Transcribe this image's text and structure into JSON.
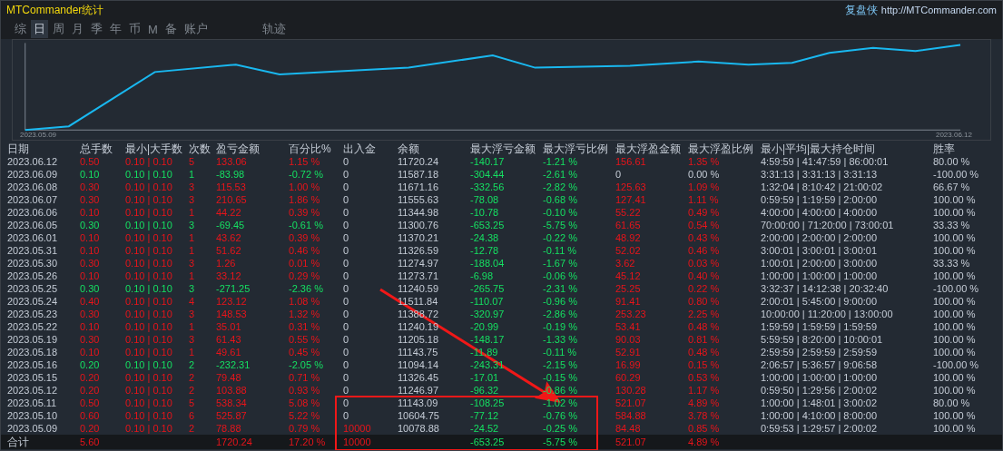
{
  "window": {
    "title": "MTCommander统计",
    "brand": "复盘侠",
    "link": "http://MTCommander.com"
  },
  "tabs": [
    {
      "label": "综",
      "selected": false
    },
    {
      "label": "日",
      "selected": true
    },
    {
      "label": "周",
      "selected": false
    },
    {
      "label": "月",
      "selected": false
    },
    {
      "label": "季",
      "selected": false
    },
    {
      "label": "年",
      "selected": false
    },
    {
      "label": "币",
      "selected": false
    },
    {
      "label": "M",
      "selected": false
    },
    {
      "label": "备",
      "selected": false
    },
    {
      "label": "账户",
      "selected": false
    }
  ],
  "extra_tab": {
    "label": "轨迹",
    "selected": false
  },
  "chart": {
    "start_label": "2023.05.09",
    "end_label": "2023.06.12"
  },
  "columns": [
    "日期",
    "总手数",
    "最小|大手数",
    "次数",
    "盈亏金额",
    "百分比%",
    "出入金",
    "余额",
    "最大浮亏金额",
    "最大浮亏比例",
    "最大浮盈金额",
    "最大浮盈比例",
    "最小|平均|最大持仓时间",
    "胜率"
  ],
  "rows": [
    {
      "date": "2023.06.12",
      "lots": "0.50",
      "lot_range": "0.10 | 0.10",
      "trades": "5",
      "pnl": "133.06",
      "pct": "1.15 %",
      "deposit": "0",
      "balance": "11720.24",
      "max_dd": "-140.17",
      "max_dd_pct": "-1.21 %",
      "max_gain": "156.61",
      "max_gain_pct": "1.35 %",
      "hold_times": "4:59:59 | 41:47:59 | 86:00:01",
      "win_rate": "80.00 %",
      "loss": false,
      "flat_gain": false,
      "deposit_marked": false
    },
    {
      "date": "2023.06.09",
      "lots": "0.10",
      "lot_range": "0.10 | 0.10",
      "trades": "1",
      "pnl": "-83.98",
      "pct": "-0.72 %",
      "deposit": "0",
      "balance": "11587.18",
      "max_dd": "-304.44",
      "max_dd_pct": "-2.61 %",
      "max_gain": "0",
      "max_gain_pct": "0.00 %",
      "hold_times": "3:31:13 | 3:31:13 | 3:31:13",
      "win_rate": "-100.00 %",
      "loss": true,
      "flat_gain": true,
      "deposit_marked": false
    },
    {
      "date": "2023.06.08",
      "lots": "0.30",
      "lot_range": "0.10 | 0.10",
      "trades": "3",
      "pnl": "115.53",
      "pct": "1.00 %",
      "deposit": "0",
      "balance": "11671.16",
      "max_dd": "-332.56",
      "max_dd_pct": "-2.82 %",
      "max_gain": "125.63",
      "max_gain_pct": "1.09 %",
      "hold_times": "1:32:04 | 8:10:42 | 21:00:02",
      "win_rate": "66.67 %",
      "loss": false,
      "flat_gain": false,
      "deposit_marked": false
    },
    {
      "date": "2023.06.07",
      "lots": "0.30",
      "lot_range": "0.10 | 0.10",
      "trades": "3",
      "pnl": "210.65",
      "pct": "1.86 %",
      "deposit": "0",
      "balance": "11555.63",
      "max_dd": "-78.08",
      "max_dd_pct": "-0.68 %",
      "max_gain": "127.41",
      "max_gain_pct": "1.11 %",
      "hold_times": "0:59:59 | 1:19:59 | 2:00:00",
      "win_rate": "100.00 %",
      "loss": false,
      "flat_gain": false,
      "deposit_marked": false
    },
    {
      "date": "2023.06.06",
      "lots": "0.10",
      "lot_range": "0.10 | 0.10",
      "trades": "1",
      "pnl": "44.22",
      "pct": "0.39 %",
      "deposit": "0",
      "balance": "11344.98",
      "max_dd": "-10.78",
      "max_dd_pct": "-0.10 %",
      "max_gain": "55.22",
      "max_gain_pct": "0.49 %",
      "hold_times": "4:00:00 | 4:00:00 | 4:00:00",
      "win_rate": "100.00 %",
      "loss": false,
      "flat_gain": false,
      "deposit_marked": false
    },
    {
      "date": "2023.06.05",
      "lots": "0.30",
      "lot_range": "0.10 | 0.10",
      "trades": "3",
      "pnl": "-69.45",
      "pct": "-0.61 %",
      "deposit": "0",
      "balance": "11300.76",
      "max_dd": "-653.25",
      "max_dd_pct": "-5.75 %",
      "max_gain": "61.65",
      "max_gain_pct": "0.54 %",
      "hold_times": "70:00:00 | 71:20:00 | 73:00:01",
      "win_rate": "33.33 %",
      "loss": true,
      "flat_gain": false,
      "deposit_marked": false
    },
    {
      "date": "2023.06.01",
      "lots": "0.10",
      "lot_range": "0.10 | 0.10",
      "trades": "1",
      "pnl": "43.62",
      "pct": "0.39 %",
      "deposit": "0",
      "balance": "11370.21",
      "max_dd": "-24.38",
      "max_dd_pct": "-0.22 %",
      "max_gain": "48.92",
      "max_gain_pct": "0.43 %",
      "hold_times": "2:00:00 | 2:00:00 | 2:00:00",
      "win_rate": "100.00 %",
      "loss": false,
      "flat_gain": false,
      "deposit_marked": false
    },
    {
      "date": "2023.05.31",
      "lots": "0.10",
      "lot_range": "0.10 | 0.10",
      "trades": "1",
      "pnl": "51.62",
      "pct": "0.46 %",
      "deposit": "0",
      "balance": "11326.59",
      "max_dd": "-12.78",
      "max_dd_pct": "-0.11 %",
      "max_gain": "52.02",
      "max_gain_pct": "0.46 %",
      "hold_times": "3:00:01 | 3:00:01 | 3:00:01",
      "win_rate": "100.00 %",
      "loss": false,
      "flat_gain": false,
      "deposit_marked": false
    },
    {
      "date": "2023.05.30",
      "lots": "0.30",
      "lot_range": "0.10 | 0.10",
      "trades": "3",
      "pnl": "1.26",
      "pct": "0.01 %",
      "deposit": "0",
      "balance": "11274.97",
      "max_dd": "-188.04",
      "max_dd_pct": "-1.67 %",
      "max_gain": "3.62",
      "max_gain_pct": "0.03 %",
      "hold_times": "1:00:01 | 2:00:00 | 3:00:00",
      "win_rate": "33.33 %",
      "loss": false,
      "flat_gain": false,
      "deposit_marked": false
    },
    {
      "date": "2023.05.26",
      "lots": "0.10",
      "lot_range": "0.10 | 0.10",
      "trades": "1",
      "pnl": "33.12",
      "pct": "0.29 %",
      "deposit": "0",
      "balance": "11273.71",
      "max_dd": "-6.98",
      "max_dd_pct": "-0.06 %",
      "max_gain": "45.12",
      "max_gain_pct": "0.40 %",
      "hold_times": "1:00:00 | 1:00:00 | 1:00:00",
      "win_rate": "100.00 %",
      "loss": false,
      "flat_gain": false,
      "deposit_marked": false
    },
    {
      "date": "2023.05.25",
      "lots": "0.30",
      "lot_range": "0.10 | 0.10",
      "trades": "3",
      "pnl": "-271.25",
      "pct": "-2.36 %",
      "deposit": "0",
      "balance": "11240.59",
      "max_dd": "-265.75",
      "max_dd_pct": "-2.31 %",
      "max_gain": "25.25",
      "max_gain_pct": "0.22 %",
      "hold_times": "3:32:37 | 14:12:38 | 20:32:40",
      "win_rate": "-100.00 %",
      "loss": true,
      "flat_gain": false,
      "deposit_marked": false
    },
    {
      "date": "2023.05.24",
      "lots": "0.40",
      "lot_range": "0.10 | 0.10",
      "trades": "4",
      "pnl": "123.12",
      "pct": "1.08 %",
      "deposit": "0",
      "balance": "11511.84",
      "max_dd": "-110.07",
      "max_dd_pct": "-0.96 %",
      "max_gain": "91.41",
      "max_gain_pct": "0.80 %",
      "hold_times": "2:00:01 | 5:45:00 | 9:00:00",
      "win_rate": "100.00 %",
      "loss": false,
      "flat_gain": false,
      "deposit_marked": false
    },
    {
      "date": "2023.05.23",
      "lots": "0.30",
      "lot_range": "0.10 | 0.10",
      "trades": "3",
      "pnl": "148.53",
      "pct": "1.32 %",
      "deposit": "0",
      "balance": "11388.72",
      "max_dd": "-320.97",
      "max_dd_pct": "-2.86 %",
      "max_gain": "253.23",
      "max_gain_pct": "2.25 %",
      "hold_times": "10:00:00 | 11:20:00 | 13:00:00",
      "win_rate": "100.00 %",
      "loss": false,
      "flat_gain": false,
      "deposit_marked": false
    },
    {
      "date": "2023.05.22",
      "lots": "0.10",
      "lot_range": "0.10 | 0.10",
      "trades": "1",
      "pnl": "35.01",
      "pct": "0.31 %",
      "deposit": "0",
      "balance": "11240.19",
      "max_dd": "-20.99",
      "max_dd_pct": "-0.19 %",
      "max_gain": "53.41",
      "max_gain_pct": "0.48 %",
      "hold_times": "1:59:59 | 1:59:59 | 1:59:59",
      "win_rate": "100.00 %",
      "loss": false,
      "flat_gain": false,
      "deposit_marked": false
    },
    {
      "date": "2023.05.19",
      "lots": "0.30",
      "lot_range": "0.10 | 0.10",
      "trades": "3",
      "pnl": "61.43",
      "pct": "0.55 %",
      "deposit": "0",
      "balance": "11205.18",
      "max_dd": "-148.17",
      "max_dd_pct": "-1.33 %",
      "max_gain": "90.03",
      "max_gain_pct": "0.81 %",
      "hold_times": "5:59:59 | 8:20:00 | 10:00:01",
      "win_rate": "100.00 %",
      "loss": false,
      "flat_gain": false,
      "deposit_marked": false
    },
    {
      "date": "2023.05.18",
      "lots": "0.10",
      "lot_range": "0.10 | 0.10",
      "trades": "1",
      "pnl": "49.61",
      "pct": "0.45 %",
      "deposit": "0",
      "balance": "11143.75",
      "max_dd": "-11.89",
      "max_dd_pct": "-0.11 %",
      "max_gain": "52.91",
      "max_gain_pct": "0.48 %",
      "hold_times": "2:59:59 | 2:59:59 | 2:59:59",
      "win_rate": "100.00 %",
      "loss": false,
      "flat_gain": false,
      "deposit_marked": false
    },
    {
      "date": "2023.05.16",
      "lots": "0.20",
      "lot_range": "0.10 | 0.10",
      "trades": "2",
      "pnl": "-232.31",
      "pct": "-2.05 %",
      "deposit": "0",
      "balance": "11094.14",
      "max_dd": "-243.31",
      "max_dd_pct": "-2.15 %",
      "max_gain": "16.99",
      "max_gain_pct": "0.15 %",
      "hold_times": "2:06:57 | 5:36:57 | 9:06:58",
      "win_rate": "-100.00 %",
      "loss": true,
      "flat_gain": false,
      "deposit_marked": false
    },
    {
      "date": "2023.05.15",
      "lots": "0.20",
      "lot_range": "0.10 | 0.10",
      "trades": "2",
      "pnl": "79.48",
      "pct": "0.71 %",
      "deposit": "0",
      "balance": "11326.45",
      "max_dd": "-17.01",
      "max_dd_pct": "-0.15 %",
      "max_gain": "60.29",
      "max_gain_pct": "0.53 %",
      "hold_times": "1:00:00 | 1:00:00 | 1:00:00",
      "win_rate": "100.00 %",
      "loss": false,
      "flat_gain": false,
      "deposit_marked": false
    },
    {
      "date": "2023.05.12",
      "lots": "0.20",
      "lot_range": "0.10 | 0.10",
      "trades": "2",
      "pnl": "103.88",
      "pct": "0.93 %",
      "deposit": "0",
      "balance": "11246.97",
      "max_dd": "-96.32",
      "max_dd_pct": "-0.86 %",
      "max_gain": "130.28",
      "max_gain_pct": "1.17 %",
      "hold_times": "0:59:50 | 1:29:56 | 2:00:02",
      "win_rate": "100.00 %",
      "loss": false,
      "flat_gain": false,
      "deposit_marked": false
    },
    {
      "date": "2023.05.11",
      "lots": "0.50",
      "lot_range": "0.10 | 0.10",
      "trades": "5",
      "pnl": "538.34",
      "pct": "5.08 %",
      "deposit": "0",
      "balance": "11143.09",
      "max_dd": "-108.25",
      "max_dd_pct": "-1.02 %",
      "max_gain": "521.07",
      "max_gain_pct": "4.89 %",
      "hold_times": "1:00:00 | 1:48:01 | 3:00:02",
      "win_rate": "80.00 %",
      "loss": false,
      "flat_gain": false,
      "deposit_marked": false
    },
    {
      "date": "2023.05.10",
      "lots": "0.60",
      "lot_range": "0.10 | 0.10",
      "trades": "6",
      "pnl": "525.87",
      "pct": "5.22 %",
      "deposit": "0",
      "balance": "10604.75",
      "max_dd": "-77.12",
      "max_dd_pct": "-0.76 %",
      "max_gain": "584.88",
      "max_gain_pct": "3.78 %",
      "hold_times": "1:00:00 | 4:10:00 | 8:00:00",
      "win_rate": "100.00 %",
      "loss": false,
      "flat_gain": false,
      "deposit_marked": false
    },
    {
      "date": "2023.05.09",
      "lots": "0.20",
      "lot_range": "0.10 | 0.10",
      "trades": "2",
      "pnl": "78.88",
      "pct": "0.79 %",
      "deposit": "10000",
      "balance": "10078.88",
      "max_dd": "-24.52",
      "max_dd_pct": "-0.25 %",
      "max_gain": "84.48",
      "max_gain_pct": "0.85 %",
      "hold_times": "0:59:53 | 1:29:57 | 2:00:02",
      "win_rate": "100.00 %",
      "loss": false,
      "flat_gain": false,
      "deposit_marked": true
    }
  ],
  "total": {
    "label": "合计",
    "lots": "5.60",
    "pnl": "1720.24",
    "pct": "17.20 %",
    "deposit": "10000",
    "max_dd": "-653.25",
    "max_dd_pct": "-5.75 %",
    "max_gain": "521.07",
    "max_gain_pct": "4.89 %"
  }
}
